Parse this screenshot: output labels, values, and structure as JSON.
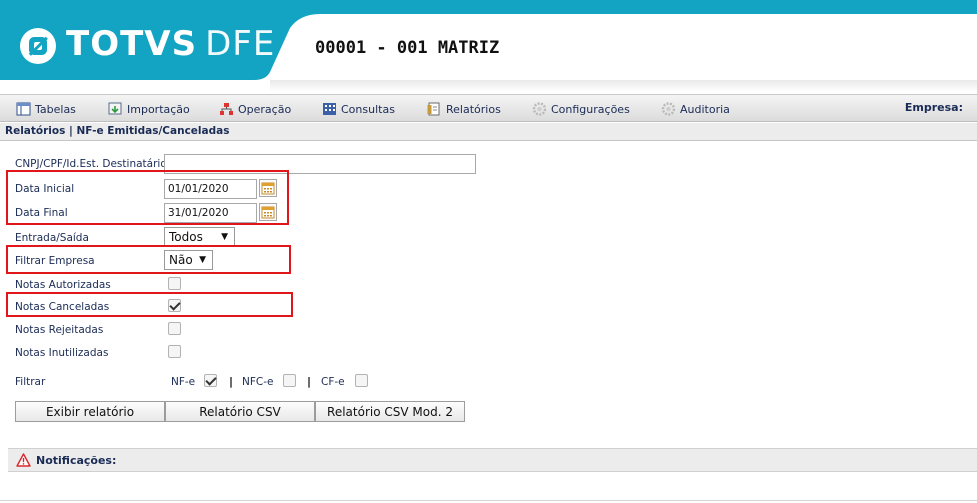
{
  "header": {
    "brand_strong": "TOTVS",
    "brand_light": "DFE",
    "company": "00001 - 001 MATRIZ"
  },
  "menu": {
    "items": [
      {
        "label": "Tabelas",
        "icon": "table-icon"
      },
      {
        "label": "Importação",
        "icon": "import-icon"
      },
      {
        "label": "Operação",
        "icon": "operation-icon"
      },
      {
        "label": "Consultas",
        "icon": "grid-icon"
      },
      {
        "label": "Relatórios",
        "icon": "report-icon"
      },
      {
        "label": "Configurações",
        "icon": "gear-icon"
      },
      {
        "label": "Auditoria",
        "icon": "gear-icon"
      }
    ],
    "empresa_label": "Empresa:"
  },
  "breadcrumb": "Relatórios | NF-e Emitidas/Canceladas",
  "form": {
    "cnpj": {
      "label": "CNPJ/CPF/Id.Est. Destinatário",
      "value": ""
    },
    "data_inicial": {
      "label": "Data Inicial",
      "value": "01/01/2020"
    },
    "data_final": {
      "label": "Data Final",
      "value": "31/01/2020"
    },
    "entrada_saida": {
      "label": "Entrada/Saída",
      "value": "Todos"
    },
    "filtrar_empresa": {
      "label": "Filtrar Empresa",
      "value": "Não"
    },
    "notas_autorizadas": {
      "label": "Notas Autorizadas",
      "checked": false
    },
    "notas_canceladas": {
      "label": "Notas Canceladas",
      "checked": true
    },
    "notas_rejeitadas": {
      "label": "Notas Rejeitadas",
      "checked": false
    },
    "notas_inutilizadas": {
      "label": "Notas Inutilizadas",
      "checked": false
    },
    "filtrar": {
      "label": "Filtrar",
      "options": [
        {
          "label": "NF-e",
          "checked": true
        },
        {
          "label": "NFC-e",
          "checked": false
        },
        {
          "label": "CF-e",
          "checked": false
        }
      ],
      "separator": "|"
    }
  },
  "buttons": {
    "exibir": "Exibir relatório",
    "csv": "Relatório CSV",
    "csv_mod2": "Relatório CSV Mod. 2"
  },
  "notifications": {
    "label": "Notificações:"
  },
  "colors": {
    "brand": "#12a4c2",
    "highlight": "#e0161b"
  }
}
